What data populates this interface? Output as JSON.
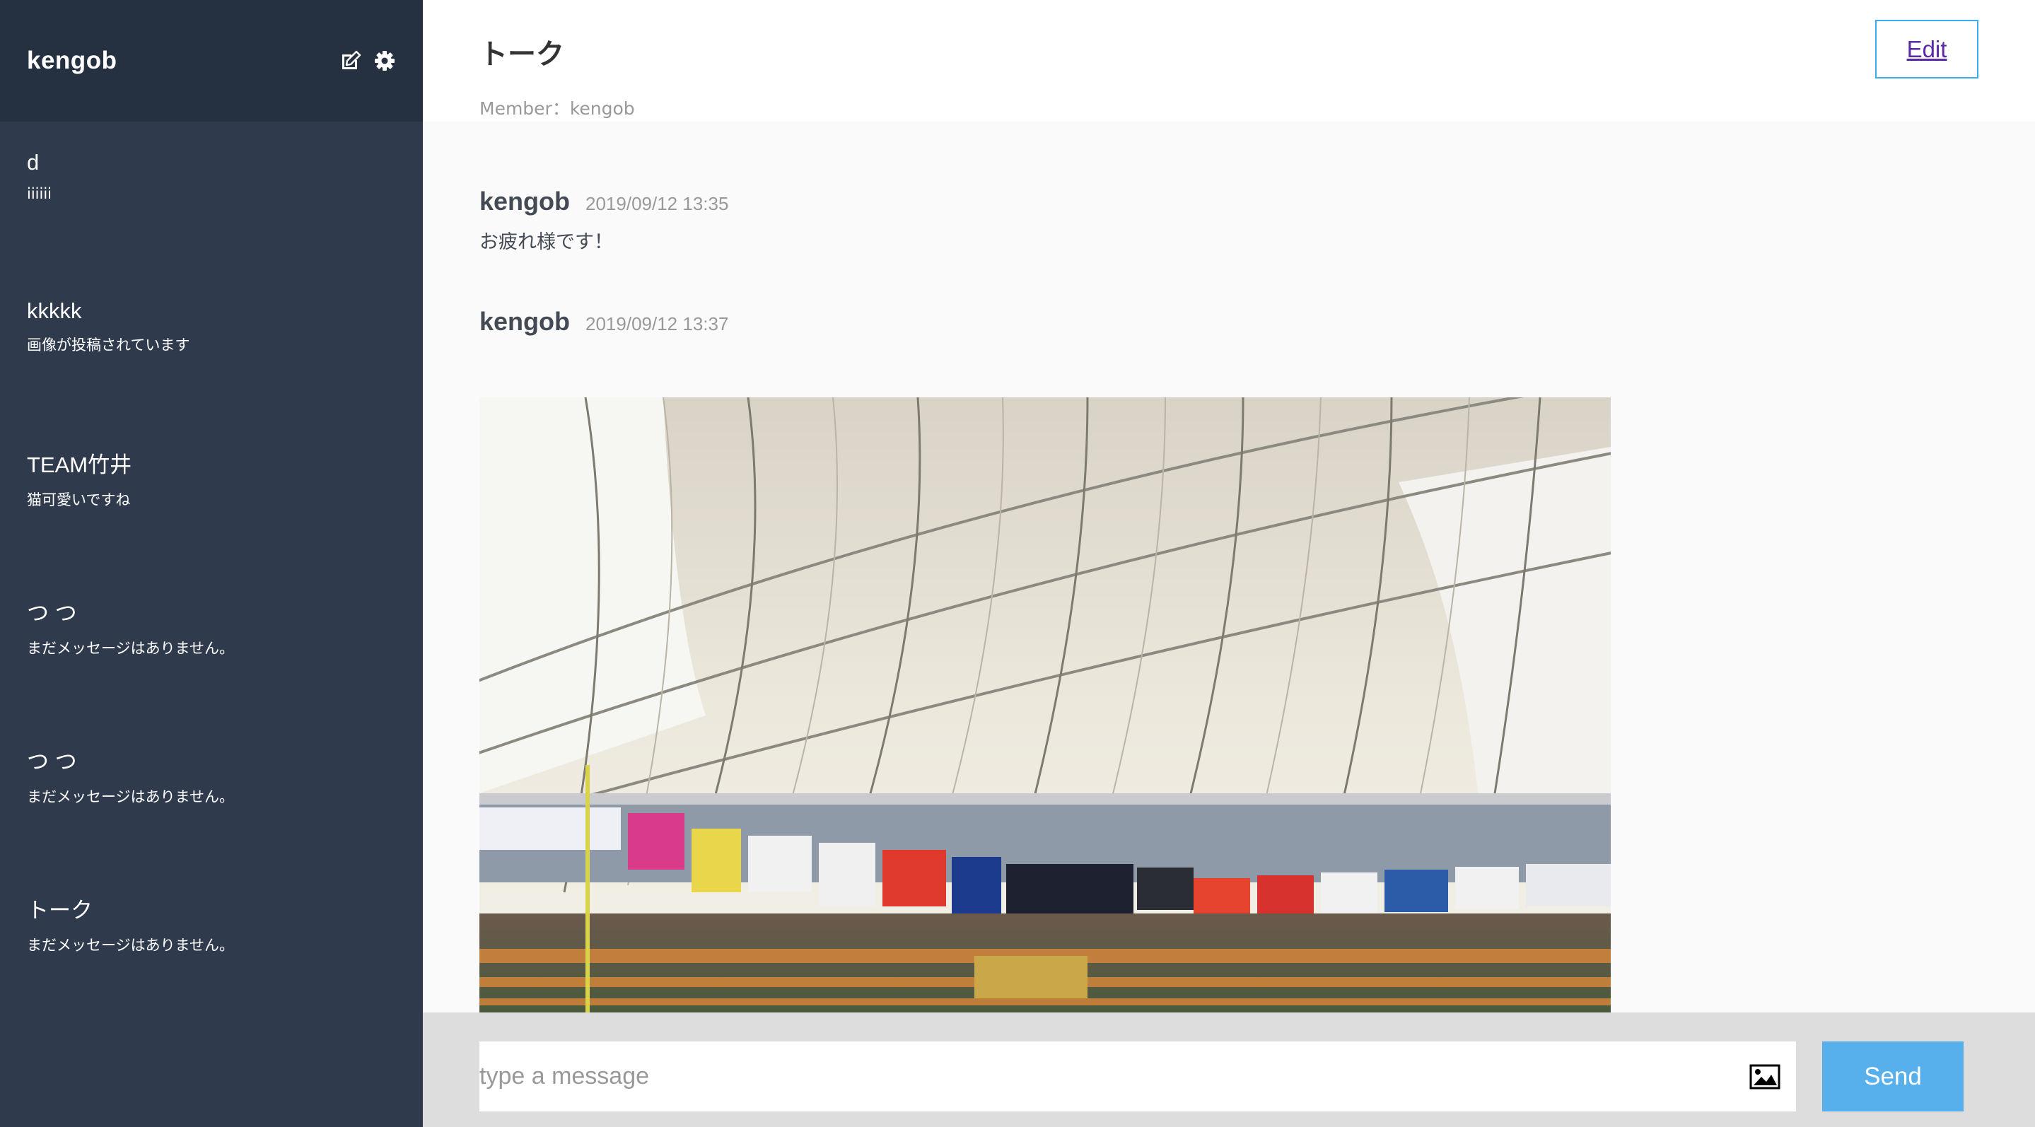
{
  "sidebar": {
    "user_name": "kengob",
    "icons": [
      "edit-icon",
      "gear-icon"
    ],
    "groups": [
      {
        "name": "d",
        "last_message": "iiiiii"
      },
      {
        "name": "kkkkk",
        "last_message": "画像が投稿されています"
      },
      {
        "name": "TEAM竹井",
        "last_message": "猫可愛いですね"
      },
      {
        "name": "つ つ",
        "last_message": "まだメッセージはありません。"
      },
      {
        "name": "つ つ",
        "last_message": "まだメッセージはありません。"
      },
      {
        "name": "トーク",
        "last_message": "まだメッセージはありません。"
      }
    ]
  },
  "main": {
    "title": "トーク",
    "members": "Member：kengob",
    "edit_label": "Edit",
    "messages": [
      {
        "user": "kengob",
        "date": "2019/09/12 13:35",
        "text": "お疲れ様です！"
      },
      {
        "user": "kengob",
        "date": "2019/09/12 13:37",
        "text": "",
        "has_image": true
      }
    ]
  },
  "form": {
    "placeholder": "type a message",
    "image_icon": "image-icon",
    "send_label": "Send"
  },
  "colors": {
    "sidebar_bg": "#2f3a4d",
    "sidebar_header_bg": "#253141",
    "send_button": "#57b0ec",
    "edit_border": "#38aef0"
  }
}
